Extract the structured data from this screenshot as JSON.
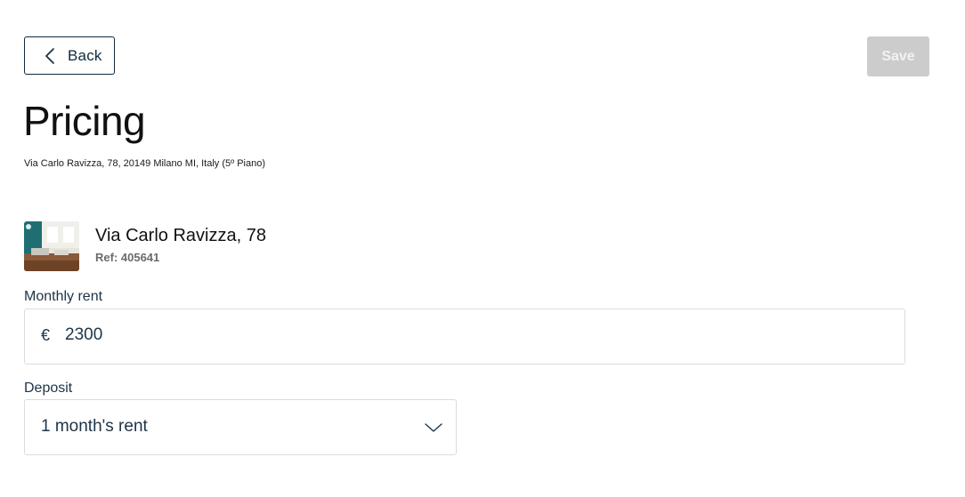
{
  "header": {
    "back_label": "Back",
    "save_label": "Save"
  },
  "page": {
    "title": "Pricing",
    "address": "Via Carlo Ravizza, 78, 20149 Milano MI, Italy (5º Piano)"
  },
  "property": {
    "name": "Via Carlo Ravizza, 78",
    "ref": "Ref: 405641"
  },
  "monthly_rent": {
    "label": "Monthly rent",
    "currency": "€",
    "value": "2300"
  },
  "deposit": {
    "label": "Deposit",
    "selected": "1 month's rent"
  },
  "icons": {
    "back": "chevron-left-icon",
    "dropdown": "chevron-down-icon"
  },
  "colors": {
    "primary": "#0f2a3f",
    "save_disabled_bg": "#cccccc",
    "border": "#dcdcdc"
  }
}
